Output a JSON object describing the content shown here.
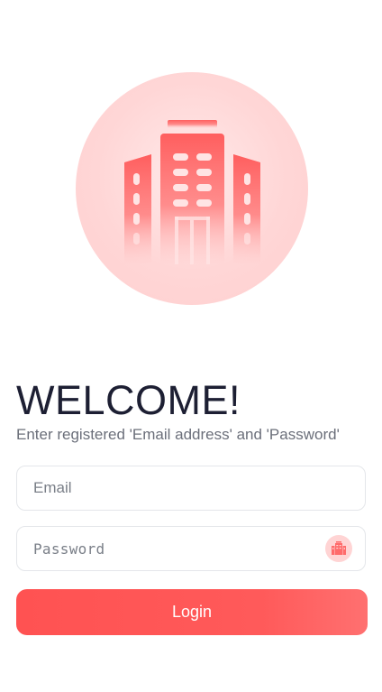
{
  "hero": {
    "icon": "building-icon",
    "colors": {
      "circle": "#ffd6d6",
      "building": "#ff6b6b"
    }
  },
  "header": {
    "title": "WELCOME!",
    "subtitle": "Enter registered 'Email address' and 'Password'"
  },
  "form": {
    "email": {
      "value": "",
      "placeholder": "Email"
    },
    "password": {
      "value": "",
      "placeholder": "Password",
      "toggle_icon": "building-icon"
    },
    "login_label": "Login"
  },
  "colors": {
    "accent": "#ff5252",
    "title": "#1d1f33",
    "subtitle": "#6b6f7a",
    "border": "#e4e6ea"
  }
}
